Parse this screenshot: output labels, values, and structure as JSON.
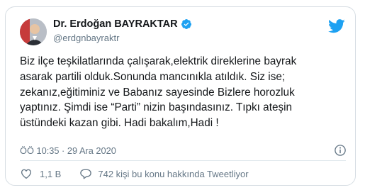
{
  "author": {
    "display_name": "Dr. Erdoğan BAYRAKTAR",
    "handle": "@erdgnbayraktr",
    "verified": true,
    "avatar_icon": "profile-photo"
  },
  "brand": {
    "icon": "twitter-bird-icon",
    "color": "#1da1f2"
  },
  "tweet": {
    "lines": [
      "Biz ilçe teşkilatlarında çalışarak,elektrik direklerine bayrak",
      "asarak partili olduk.Sonunda mancınıkla atıldık. Siz ise;",
      "zekanız,eğitiminiz ve Babanız sayesinde Bizlere horozluk",
      "yaptınız. Şimdi ise “Parti” nizin başındasınız. Tıpkı ateşin",
      "üstündeki kazan gibi. Hadi bakalım,Hadi !"
    ]
  },
  "meta": {
    "timestamp": "ÖÖ 10:35 · 29 Ara 2020",
    "info_icon": "info-icon"
  },
  "actions": {
    "like_icon": "heart-icon",
    "like_count": "1,1 B",
    "reply_icon": "speech-bubble-icon",
    "reply_text": "742 kişi bu konu hakkında Tweetliyor"
  },
  "colors": {
    "text": "#14171a",
    "secondary": "#657786",
    "border": "#d6dde3",
    "verified": "#1da1f2"
  }
}
